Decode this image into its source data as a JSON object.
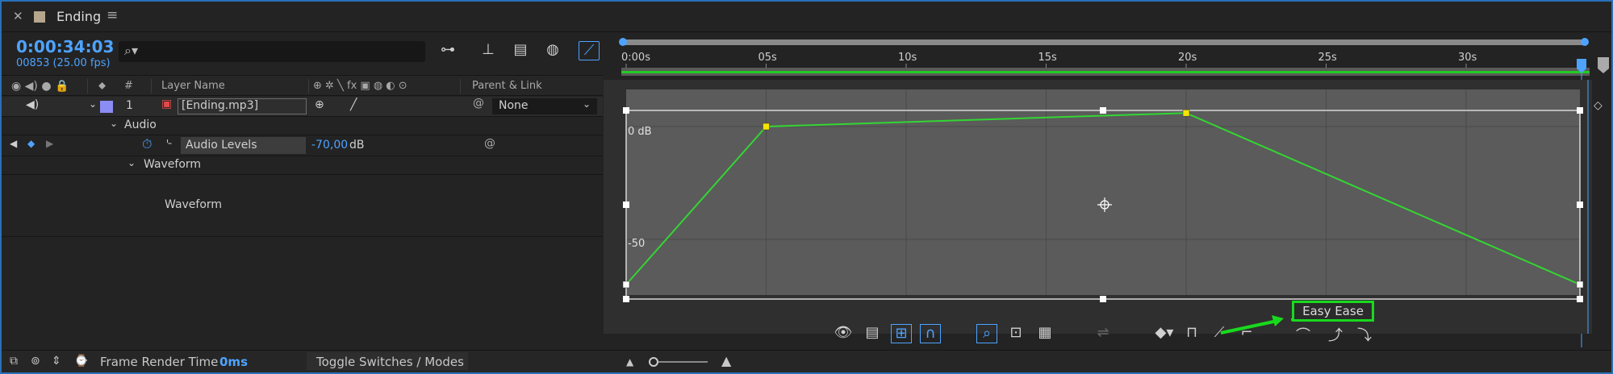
{
  "tab": {
    "title": "Ending"
  },
  "timeline": {
    "timecode": "0:00:34:03",
    "frames": "00853 (25.00 fps)"
  },
  "columns": {
    "layer_name": "Layer Name",
    "parent_link": "Parent & Link",
    "number": "#"
  },
  "layer": {
    "index": "1",
    "name": "[Ending.mp3]",
    "parent": "None"
  },
  "groups": {
    "audio": "Audio",
    "waveform": "Waveform",
    "waveform_display": "Waveform"
  },
  "property": {
    "name": "Audio Levels",
    "value": "-70,00",
    "unit": "dB"
  },
  "status": {
    "frame_render_label": "Frame Render Time",
    "frame_render_value": "0ms",
    "toggle_label": "Toggle Switches / Modes"
  },
  "ruler": {
    "ticks": [
      "0:00s",
      "05s",
      "10s",
      "15s",
      "20s",
      "25s",
      "30s"
    ]
  },
  "graph": {
    "y_labels": [
      "0 dB",
      "-50"
    ],
    "tooltip": "Easy Ease",
    "curve_color": "#33d633",
    "keyframes": [
      {
        "t": 0,
        "db": -70
      },
      {
        "t": 5,
        "db": 0
      },
      {
        "t": 20,
        "db": 6
      },
      {
        "t": 34,
        "db": -70
      }
    ]
  },
  "colors": {
    "accent": "#4ea3ff",
    "highlight": "#19d91e",
    "label": "#8c8cf5"
  }
}
